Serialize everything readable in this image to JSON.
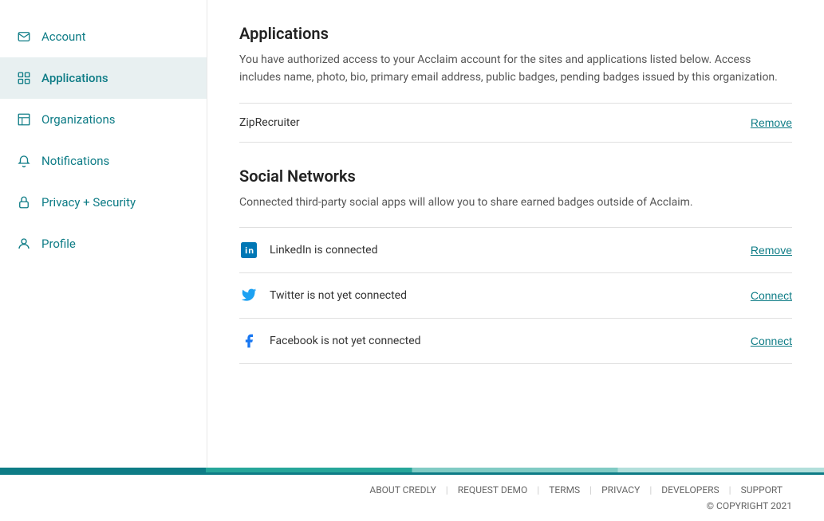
{
  "sidebar": {
    "items": [
      {
        "id": "account",
        "label": "Account",
        "icon": "envelope-icon",
        "active": false
      },
      {
        "id": "applications",
        "label": "Applications",
        "icon": "grid-icon",
        "active": true
      },
      {
        "id": "organizations",
        "label": "Organizations",
        "icon": "building-icon",
        "active": false
      },
      {
        "id": "notifications",
        "label": "Notifications",
        "icon": "bell-icon",
        "active": false
      },
      {
        "id": "privacy-security",
        "label": "Privacy + Security",
        "icon": "lock-icon",
        "active": false
      },
      {
        "id": "profile",
        "label": "Profile",
        "icon": "user-icon",
        "active": false
      }
    ]
  },
  "applications": {
    "section_title": "Applications",
    "section_desc": "You have authorized access to your Acclaim account for the sites and applications listed below. Access includes name, photo, bio, primary email address, public badges, pending badges issued by this organization.",
    "apps": [
      {
        "name": "ZipRecruiter",
        "action_label": "Remove"
      }
    ]
  },
  "social_networks": {
    "section_title": "Social Networks",
    "section_desc": "Connected third-party social apps will allow you to share earned badges outside of Acclaim.",
    "networks": [
      {
        "id": "linkedin",
        "label": "LinkedIn is connected",
        "action_label": "Remove",
        "action_type": "remove"
      },
      {
        "id": "twitter",
        "label": "Twitter is not yet connected",
        "action_label": "Connect",
        "action_type": "connect"
      },
      {
        "id": "facebook",
        "label": "Facebook is not yet connected",
        "action_label": "Connect",
        "action_type": "connect"
      }
    ]
  },
  "footer": {
    "links": [
      {
        "label": "ABOUT CREDLY"
      },
      {
        "label": "REQUEST DEMO"
      },
      {
        "label": "TERMS"
      },
      {
        "label": "PRIVACY"
      },
      {
        "label": "DEVELOPERS"
      },
      {
        "label": "SUPPORT"
      }
    ],
    "copyright": "© COPYRIGHT 2021"
  }
}
